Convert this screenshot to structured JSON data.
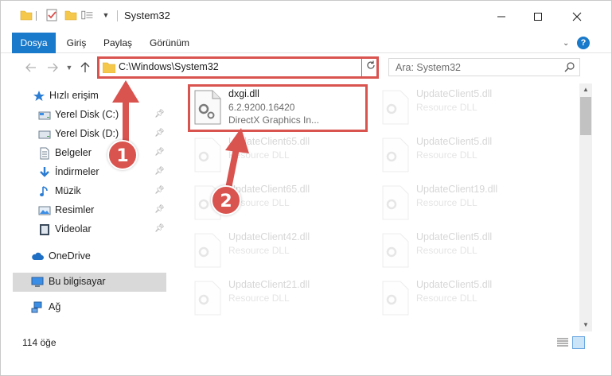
{
  "window": {
    "title": "System32",
    "controls": {
      "minimize": "minimize-icon",
      "maximize": "maximize-icon",
      "close": "close-icon"
    }
  },
  "ribbon": {
    "tabs": [
      {
        "label": "Dosya",
        "active": true
      },
      {
        "label": "Giriş"
      },
      {
        "label": "Paylaş"
      },
      {
        "label": "Görünüm"
      }
    ],
    "help": "?"
  },
  "navbar": {
    "address": "C:\\Windows\\System32",
    "search_placeholder": "Ara: System32"
  },
  "sidebar": {
    "items": [
      {
        "label": "Hızlı erişim",
        "icon": "star-icon"
      },
      {
        "label": "Yerel Disk (C:)",
        "icon": "drive-icon",
        "pinned": true
      },
      {
        "label": "Yerel Disk (D:)",
        "icon": "drive-icon",
        "pinned": true
      },
      {
        "label": "Belgeler",
        "icon": "documents-icon",
        "pinned": true
      },
      {
        "label": "İndirmeler",
        "icon": "download-icon",
        "pinned": true
      },
      {
        "label": "Müzik",
        "icon": "music-icon",
        "pinned": true
      },
      {
        "label": "Resimler",
        "icon": "pictures-icon",
        "pinned": true
      },
      {
        "label": "Videolar",
        "icon": "video-icon",
        "pinned": true
      },
      {
        "label": "OneDrive",
        "icon": "cloud-icon"
      },
      {
        "label": "Bu bilgisayar",
        "icon": "computer-icon",
        "selected": true
      },
      {
        "label": "Ağ",
        "icon": "network-icon"
      }
    ]
  },
  "files": {
    "highlighted": {
      "name": "dxgi.dll",
      "version": "6.2.9200.16420",
      "description": "DirectX Graphics In..."
    },
    "left_column": [
      {
        "name": "UpdateClient65.dll",
        "description": "Resource DLL"
      },
      {
        "name": "UpdateClient65.dll",
        "description": "Resource DLL"
      },
      {
        "name": "UpdateClient42.dll",
        "description": "Resource DLL"
      },
      {
        "name": "UpdateClient21.dll",
        "description": "Resource DLL"
      }
    ],
    "right_column": [
      {
        "name": "UpdateClient5.dll",
        "description": "Resource DLL"
      },
      {
        "name": "UpdateClient5.dll",
        "description": "Resource DLL"
      },
      {
        "name": "UpdateClient19.dll",
        "description": "Resource DLL"
      },
      {
        "name": "UpdateClient5.dll",
        "description": "Resource DLL"
      },
      {
        "name": "UpdateClient5.dll",
        "description": "Resource DLL"
      }
    ]
  },
  "status": {
    "count": "114 öğe"
  },
  "annotations": {
    "step1": "1",
    "step2": "2"
  },
  "colors": {
    "accent": "#1979ca",
    "annotation": "#d9534f",
    "selected": "#d9d9d9"
  }
}
